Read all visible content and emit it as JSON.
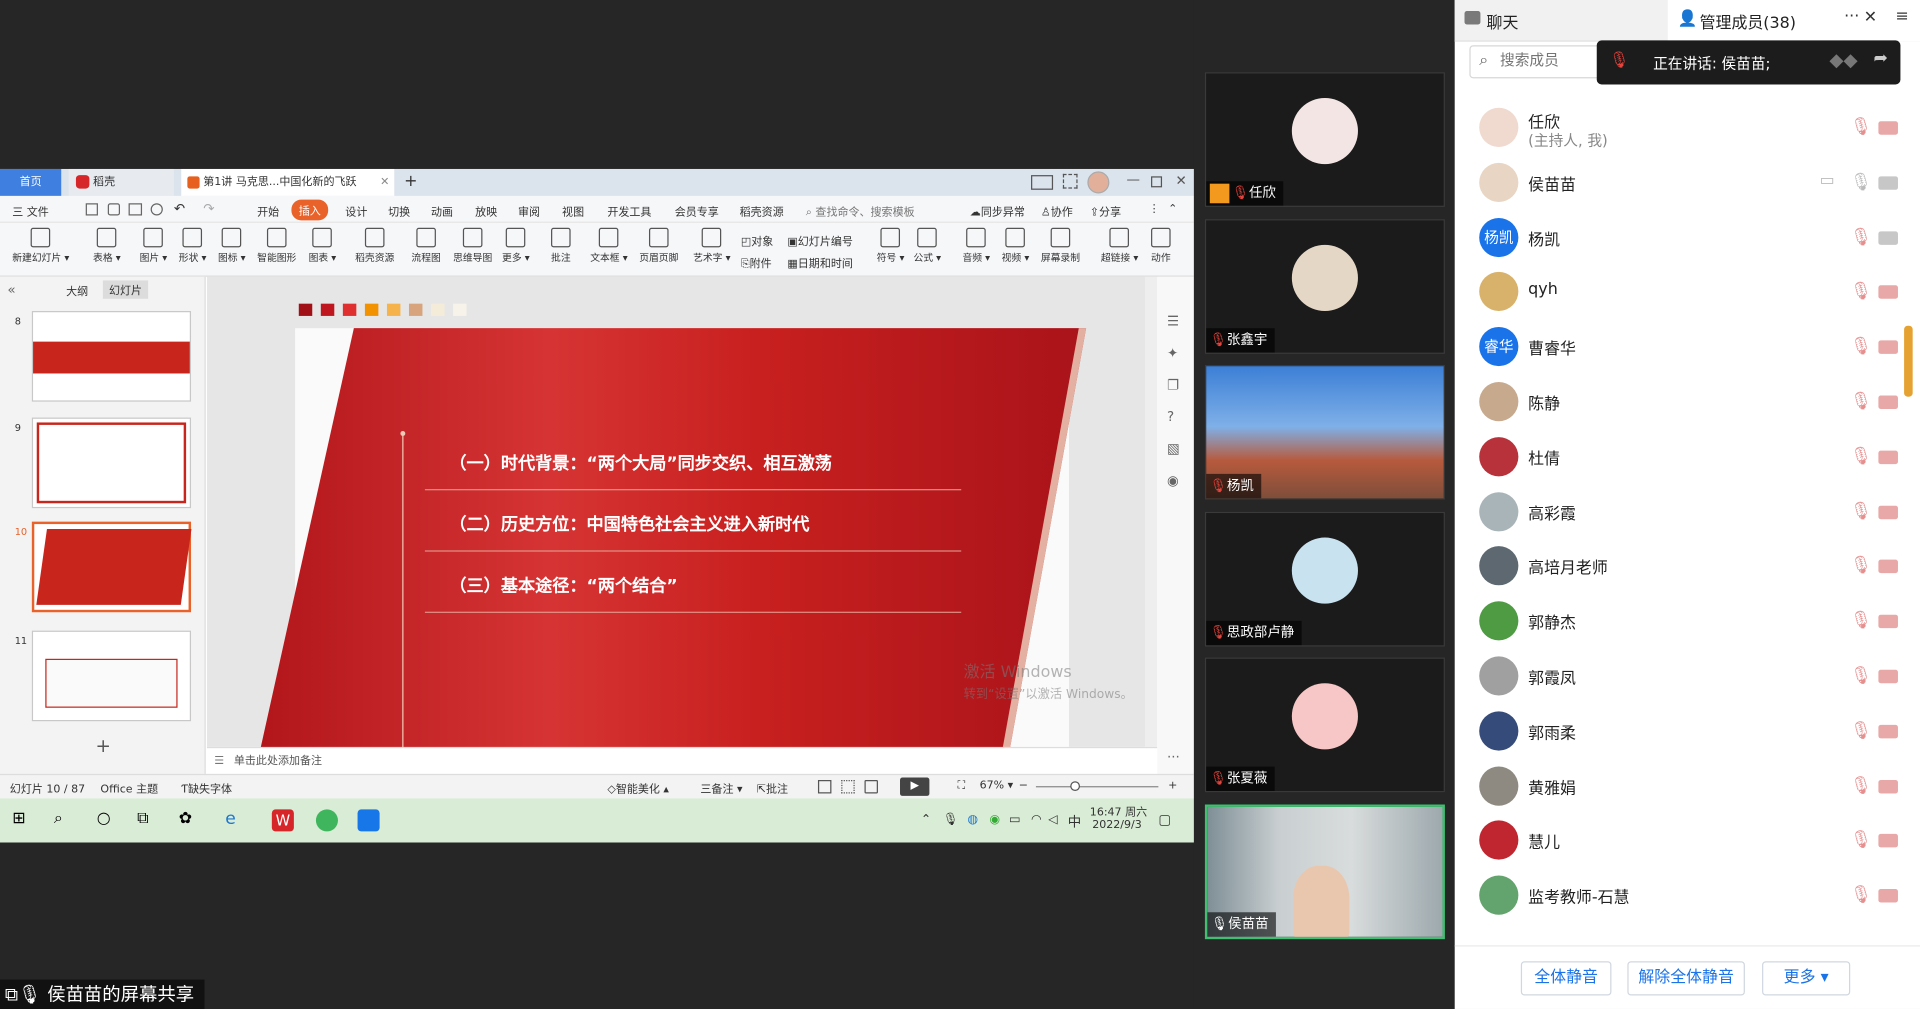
{
  "wps": {
    "tabs": {
      "home": "首页",
      "docer": "稻壳",
      "doc": "第1讲 马克思...中国化新的飞跃",
      "new": "+"
    },
    "menu": {
      "file": "三 文件",
      "start": "开始",
      "insert": "插入",
      "design": "设计",
      "switch": "切换",
      "animation": "动画",
      "show": "放映",
      "review": "审阅",
      "view": "视图",
      "dev": "开发工具",
      "member": "会员专享",
      "docer_res": "稻壳资源",
      "search": "查找命令、搜索模板",
      "sync": "同步异常",
      "collab": "协作",
      "share": "分享"
    },
    "ribbon": [
      {
        "label": "新建幻灯片 ▾",
        "icon": "new-slide-icon"
      },
      {
        "label": "表格 ▾",
        "icon": "table-icon"
      },
      {
        "label": "图片 ▾",
        "icon": "picture-icon"
      },
      {
        "label": "形状 ▾",
        "icon": "shape-icon"
      },
      {
        "label": "图标 ▾",
        "icon": "icons-icon"
      },
      {
        "label": "智能图形",
        "icon": "smart-art-icon"
      },
      {
        "label": "图表 ▾",
        "icon": "chart-icon"
      },
      {
        "label": "稻壳资源",
        "icon": "docer-res-icon"
      },
      {
        "label": "流程图",
        "icon": "flowchart-icon"
      },
      {
        "label": "思维导图",
        "icon": "mindmap-icon"
      },
      {
        "label": "更多 ▾",
        "icon": "more-icon"
      },
      {
        "label": "批注",
        "icon": "comment-icon"
      },
      {
        "label": "文本框 ▾",
        "icon": "textbox-icon"
      },
      {
        "label": "页眉页脚",
        "icon": "header-footer-icon"
      },
      {
        "label": "艺术字 ▾",
        "icon": "art-text-icon"
      },
      {
        "label": "符号 ▾",
        "icon": "symbol-icon"
      },
      {
        "label": "公式 ▾",
        "icon": "formula-icon"
      },
      {
        "label": "音频 ▾",
        "icon": "audio-icon"
      },
      {
        "label": "视频 ▾",
        "icon": "video-icon"
      },
      {
        "label": "屏幕录制",
        "icon": "screen-record-icon"
      },
      {
        "label": "超链接 ▾",
        "icon": "hyperlink-icon"
      },
      {
        "label": "动作",
        "icon": "action-icon"
      }
    ],
    "ribbon_small": {
      "object": "对象",
      "attach": "附件",
      "slide_no": "幻灯片编号",
      "date": "日期和时间"
    },
    "panel_tabs": {
      "outline": "大纲",
      "slides": "幻灯片"
    },
    "slides": [
      {
        "num": "8"
      },
      {
        "num": "9"
      },
      {
        "num": "10"
      },
      {
        "num": "11"
      }
    ],
    "slide": {
      "lines": [
        "（一）时代背景：“两个大局”同步交织、相互激荡",
        "（二）历史方位：中国特色社会主义进入新时代",
        "（三）基本途径：“两个结合”"
      ]
    },
    "swatches": [
      "#a10f17",
      "#c0161f",
      "#e02f2f",
      "#f39200",
      "#f6b24b",
      "#d8a47e",
      "#f4ecd8",
      "#f7f3ea"
    ],
    "notes_placeholder": "单击此处添加备注",
    "watermark": {
      "line1": "激活 Windows",
      "line2": "转到“设置”以激活 Windows。"
    },
    "status": {
      "slide": "幻灯片 10 / 87",
      "theme": "Office 主题",
      "font": "缺失字体",
      "beautify": "智能美化 ▴",
      "notes": "三备注 ▾",
      "comment": "批注",
      "zoom": "67% ▾"
    },
    "clock": {
      "time": "16:47 周六",
      "date": "2022/9/3",
      "ime": "中"
    }
  },
  "share_label": "侯苗苗的屏幕共享",
  "tiles": [
    {
      "name": "任欣"
    },
    {
      "name": "张鑫宇"
    },
    {
      "name": "杨凯"
    },
    {
      "name": "思政部卢静"
    },
    {
      "name": "张夏薇"
    },
    {
      "name": "侯苗苗"
    }
  ],
  "panel": {
    "tab_chat": "聊天",
    "tab_members": "管理成员(38)",
    "more": "···",
    "close": "✕",
    "search_placeholder": "搜索成员",
    "speaking": "正在讲话: 侯苗苗;",
    "members": [
      {
        "name": "任欣",
        "sub": "(主持人, 我)"
      },
      {
        "name": "侯苗苗",
        "sub": ""
      },
      {
        "name": "杨凯",
        "sub": "",
        "avatar_text": "杨凯"
      },
      {
        "name": "qyh",
        "sub": ""
      },
      {
        "name": "曹睿华",
        "sub": "",
        "avatar_text": "睿华"
      },
      {
        "name": "陈静",
        "sub": ""
      },
      {
        "name": "杜倩",
        "sub": ""
      },
      {
        "name": "高彩霞",
        "sub": ""
      },
      {
        "name": "高培月老师",
        "sub": ""
      },
      {
        "name": "郭静杰",
        "sub": ""
      },
      {
        "name": "郭霞凤",
        "sub": ""
      },
      {
        "name": "郭雨柔",
        "sub": ""
      },
      {
        "name": "黄雅娟",
        "sub": ""
      },
      {
        "name": "慧儿",
        "sub": ""
      },
      {
        "name": "监考教师-石慧",
        "sub": ""
      }
    ],
    "buttons": {
      "mute_all": "全体静音",
      "unmute_all": "解除全体静音",
      "more": "更多 ▾"
    }
  },
  "colors": {
    "accent": "#1a73e8",
    "wps_red": "#c9251d",
    "tile_border_active": "#3fbf6f"
  }
}
